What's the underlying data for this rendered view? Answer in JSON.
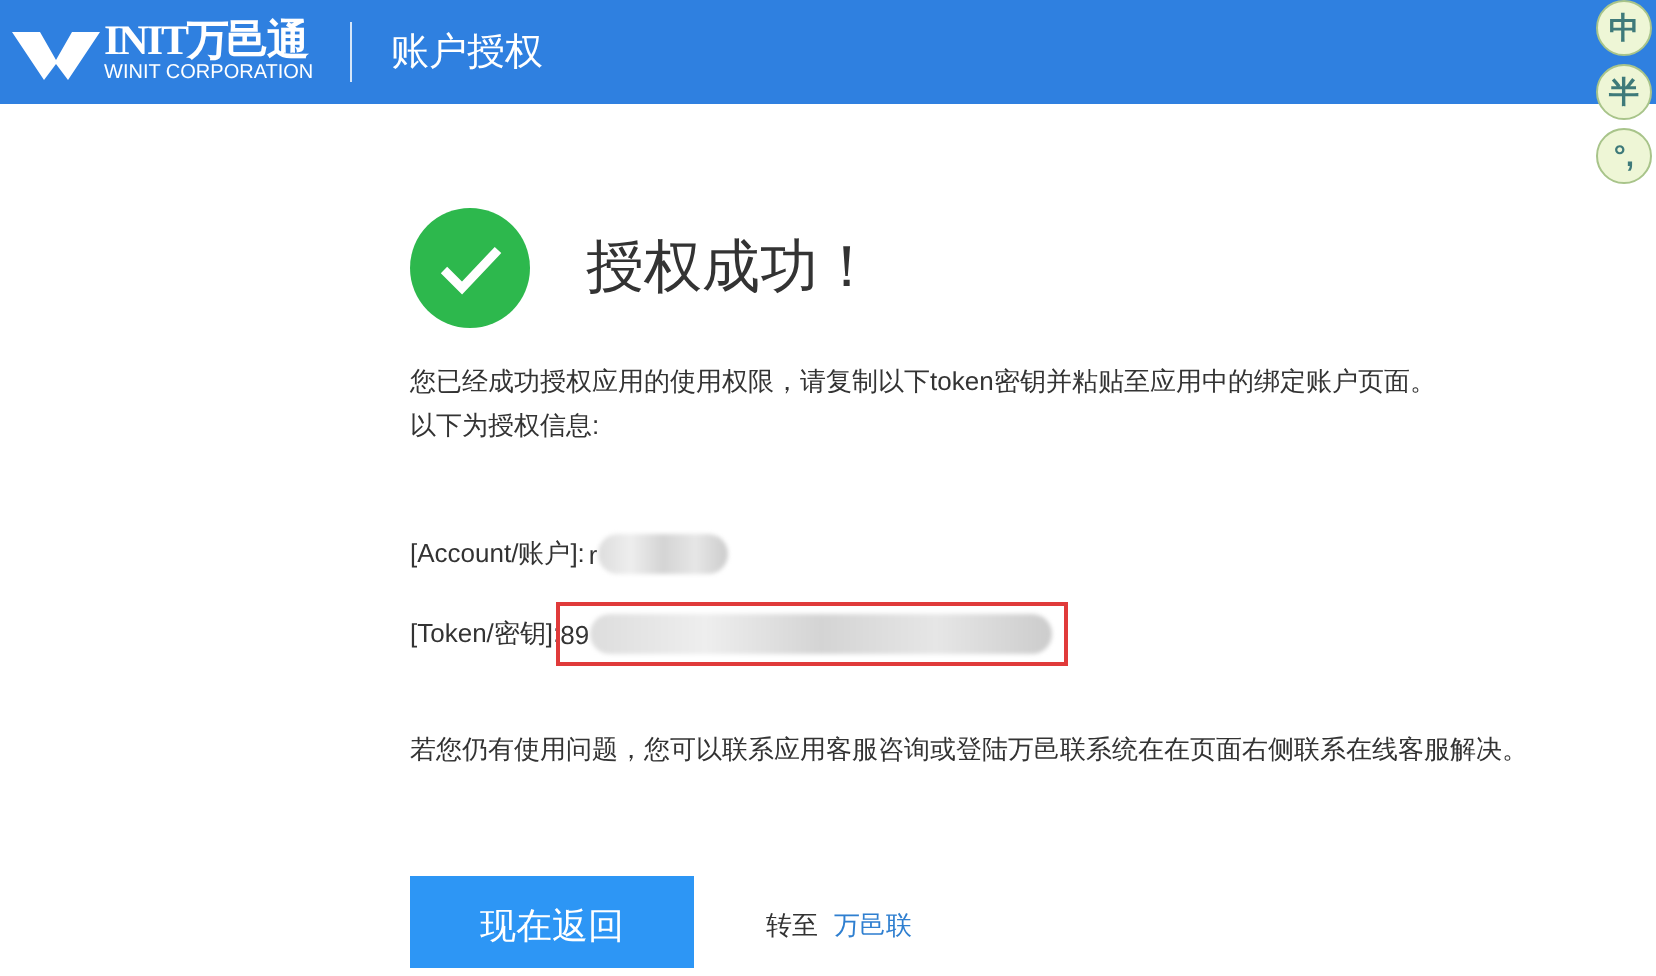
{
  "header": {
    "logo_mark": "INIT万邑通",
    "logo_sub": "WINIT CORPORATION",
    "title": "账户授权"
  },
  "ime_toolbar": [
    {
      "label": "中"
    },
    {
      "label": "半"
    },
    {
      "label": "°,"
    }
  ],
  "result": {
    "success": true,
    "title": "授权成功！"
  },
  "intro": [
    "您已经成功授权应用的使用权限，请复制以下token密钥并粘贴至应用中的绑定账户页面。",
    "以下为授权信息:"
  ],
  "fields": [
    {
      "label": "[Account/账户]:",
      "value": "r",
      "highlighted": false
    },
    {
      "label": "[Token/密钥]:",
      "value": "89",
      "highlighted": true
    }
  ],
  "help": "若您仍有使用问题，您可以联系应用客服咨询或登陆万邑联系统在在页面右侧联系在线客服解决。",
  "actions": {
    "button": "现在返回",
    "goto_label": "转至",
    "goto_link": "万邑联"
  }
}
